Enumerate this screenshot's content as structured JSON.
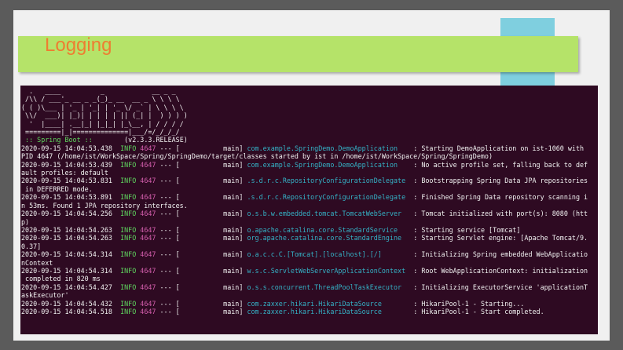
{
  "slide": {
    "title": "Logging"
  },
  "terminal": {
    "ascii_art": [
      "  .   ____          _            __ _ _",
      " /\\\\ / ___'_ __ _ _(_)_ __  __ _ \\ \\ \\ \\",
      "( ( )\\___ | '_ | '_| | '_ \\/ _` | \\ \\ \\ \\",
      " \\\\/  ___)| |_)| | | | | || (_| |  ) ) ) )",
      "  '  |____| .__|_| |_|_| |_\\__, | / / / /",
      " =========|_|==============|___/=/_/_/_/"
    ],
    "banner_label": " :: Spring Boot ::        ",
    "banner_version": "(v2.3.3.RELEASE)",
    "logs": [
      {
        "ts": "2020-09-15 14:04:53.438",
        "level": "INFO",
        "pid": "4647",
        "sep": " --- [           main] ",
        "logger": "com.example.SpringDemo.DemoApplication   ",
        "msg": " : Starting DemoApplication on ist-1060 with",
        "cont": "PID 4647 (/home/ist/WorkSpace/Spring/SpringDemo/target/classes started by ist in /home/ist/WorkSpace/Spring/SpringDemo)"
      },
      {
        "ts": "2020-09-15 14:04:53.439",
        "level": "INFO",
        "pid": "4647",
        "sep": " --- [           main] ",
        "logger": "com.example.SpringDemo.DemoApplication   ",
        "msg": " : No active profile set, falling back to def",
        "cont": "ault profiles: default"
      },
      {
        "ts": "2020-09-15 14:04:53.831",
        "level": "INFO",
        "pid": "4647",
        "sep": " --- [           main] ",
        "logger": ".s.d.r.c.RepositoryConfigurationDelegate ",
        "msg": " : Bootstrapping Spring Data JPA repositories",
        "cont": " in DEFERRED mode."
      },
      {
        "ts": "2020-09-15 14:04:53.891",
        "level": "INFO",
        "pid": "4647",
        "sep": " --- [           main] ",
        "logger": ".s.d.r.c.RepositoryConfigurationDelegate ",
        "msg": " : Finished Spring Data repository scanning i",
        "cont": "n 53ms. Found 1 JPA repository interfaces."
      },
      {
        "ts": "2020-09-15 14:04:54.256",
        "level": "INFO",
        "pid": "4647",
        "sep": " --- [           main] ",
        "logger": "o.s.b.w.embedded.tomcat.TomcatWebServer  ",
        "msg": " : Tomcat initialized with port(s): 8080 (htt",
        "cont": "p)"
      },
      {
        "ts": "2020-09-15 14:04:54.263",
        "level": "INFO",
        "pid": "4647",
        "sep": " --- [           main] ",
        "logger": "o.apache.catalina.core.StandardService   ",
        "msg": " : Starting service [Tomcat]",
        "cont": ""
      },
      {
        "ts": "2020-09-15 14:04:54.263",
        "level": "INFO",
        "pid": "4647",
        "sep": " --- [           main] ",
        "logger": "org.apache.catalina.core.StandardEngine  ",
        "msg": " : Starting Servlet engine: [Apache Tomcat/9.",
        "cont": "0.37]"
      },
      {
        "ts": "2020-09-15 14:04:54.314",
        "level": "INFO",
        "pid": "4647",
        "sep": " --- [           main] ",
        "logger": "o.a.c.c.C.[Tomcat].[localhost].[/]       ",
        "msg": " : Initializing Spring embedded WebApplicatio",
        "cont": "nContext"
      },
      {
        "ts": "2020-09-15 14:04:54.314",
        "level": "INFO",
        "pid": "4647",
        "sep": " --- [           main] ",
        "logger": "w.s.c.ServletWebServerApplicationContext ",
        "msg": " : Root WebApplicationContext: initialization",
        "cont": " completed in 820 ms"
      },
      {
        "ts": "2020-09-15 14:04:54.427",
        "level": "INFO",
        "pid": "4647",
        "sep": " --- [           main] ",
        "logger": "o.s.s.concurrent.ThreadPoolTaskExecutor  ",
        "msg": " : Initializing ExecutorService 'applicationT",
        "cont": "askExecutor'"
      },
      {
        "ts": "2020-09-15 14:04:54.432",
        "level": "INFO",
        "pid": "4647",
        "sep": " --- [           main] ",
        "logger": "com.zaxxer.hikari.HikariDataSource       ",
        "msg": " : HikariPool-1 - Starting...",
        "cont": ""
      },
      {
        "ts": "2020-09-15 14:04:54.518",
        "level": "INFO",
        "pid": "4647",
        "sep": " --- [           main] ",
        "logger": "com.zaxxer.hikari.HikariDataSource       ",
        "msg": " : HikariPool-1 - Start completed.",
        "cont": ""
      }
    ]
  }
}
